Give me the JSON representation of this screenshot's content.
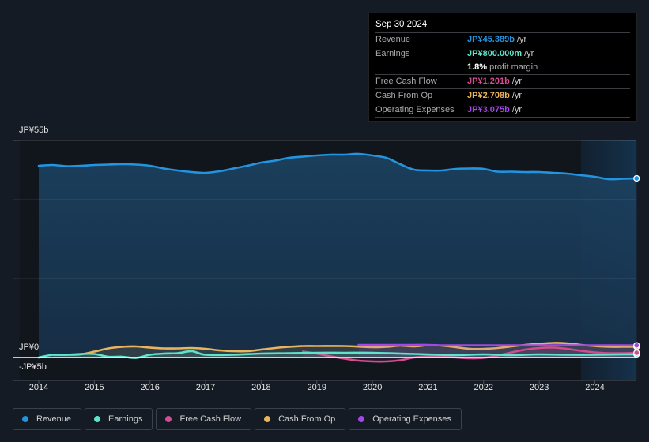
{
  "tooltip": {
    "date": "Sep 30 2024",
    "rows": [
      {
        "label": "Revenue",
        "value": "JP¥45.389b",
        "unit": "/yr",
        "color": "#2394df"
      },
      {
        "label": "Earnings",
        "value": "JP¥800.000m",
        "unit": "/yr",
        "color": "#5fe3ca"
      },
      {
        "label": "Free Cash Flow",
        "value": "JP¥1.201b",
        "unit": "/yr",
        "color": "#d14d8f"
      },
      {
        "label": "Cash From Op",
        "value": "JP¥2.708b",
        "unit": "/yr",
        "color": "#e9b45e"
      },
      {
        "label": "Operating Expenses",
        "value": "JP¥3.075b",
        "unit": "/yr",
        "color": "#a347e6"
      }
    ],
    "profit_margin": {
      "value": "1.8%",
      "text": "profit margin"
    }
  },
  "legend": [
    {
      "label": "Revenue",
      "color": "#2394df"
    },
    {
      "label": "Earnings",
      "color": "#5fe3ca"
    },
    {
      "label": "Free Cash Flow",
      "color": "#d14d8f"
    },
    {
      "label": "Cash From Op",
      "color": "#e9b45e"
    },
    {
      "label": "Operating Expenses",
      "color": "#a347e6"
    }
  ],
  "chart_data": {
    "type": "area",
    "title": "",
    "xlabel": "",
    "ylabel": "",
    "ylim": [
      -5,
      55
    ],
    "xlim": [
      2013.7,
      2024.75
    ],
    "y_ticks": [
      {
        "value": 55,
        "label": "JP¥55b"
      },
      {
        "value": 0,
        "label": "JP¥0"
      },
      {
        "value": -5,
        "label": "-JP¥5b"
      }
    ],
    "x_ticks": [
      {
        "value": 2014,
        "label": "2014"
      },
      {
        "value": 2015,
        "label": "2015"
      },
      {
        "value": 2016,
        "label": "2016"
      },
      {
        "value": 2017,
        "label": "2017"
      },
      {
        "value": 2018,
        "label": "2018"
      },
      {
        "value": 2019,
        "label": "2019"
      },
      {
        "value": 2020,
        "label": "2020"
      },
      {
        "value": 2021,
        "label": "2021"
      },
      {
        "value": 2022,
        "label": "2022"
      },
      {
        "value": 2023,
        "label": "2023"
      },
      {
        "value": 2024,
        "label": "2024"
      }
    ],
    "gridlines": [
      55,
      40,
      20
    ],
    "highlight_start": 2023.75,
    "units": "JP¥ billions",
    "series": [
      {
        "name": "Revenue",
        "color": "#2394df",
        "fill": true,
        "x": [
          2014.0,
          2014.25,
          2014.5,
          2014.75,
          2015.0,
          2015.25,
          2015.5,
          2015.75,
          2016.0,
          2016.25,
          2016.5,
          2016.75,
          2017.0,
          2017.25,
          2017.5,
          2017.75,
          2018.0,
          2018.25,
          2018.5,
          2018.75,
          2019.0,
          2019.25,
          2019.5,
          2019.75,
          2020.0,
          2020.25,
          2020.5,
          2020.75,
          2021.0,
          2021.25,
          2021.5,
          2021.75,
          2022.0,
          2022.25,
          2022.5,
          2022.75,
          2023.0,
          2023.25,
          2023.5,
          2023.75,
          2024.0,
          2024.25,
          2024.5,
          2024.75
        ],
        "values": [
          48.6,
          48.8,
          48.5,
          48.6,
          48.8,
          48.9,
          49.0,
          48.9,
          48.6,
          47.9,
          47.4,
          47.0,
          46.8,
          47.2,
          47.9,
          48.6,
          49.4,
          49.9,
          50.6,
          50.9,
          51.2,
          51.4,
          51.4,
          51.6,
          51.2,
          50.6,
          49.0,
          47.6,
          47.4,
          47.4,
          47.8,
          47.9,
          47.8,
          47.1,
          47.1,
          47.0,
          47.0,
          46.8,
          46.6,
          46.2,
          45.8,
          45.2,
          45.3,
          45.4
        ]
      },
      {
        "name": "Earnings",
        "color": "#5fe3ca",
        "fill": false,
        "x": [
          2014.0,
          2014.25,
          2014.5,
          2014.75,
          2015.0,
          2015.25,
          2015.5,
          2015.75,
          2016.0,
          2016.25,
          2016.5,
          2016.75,
          2017.0,
          2017.5,
          2018.0,
          2018.5,
          2019.0,
          2019.5,
          2020.0,
          2020.5,
          2021.0,
          2021.5,
          2022.0,
          2022.5,
          2023.0,
          2023.5,
          2024.0,
          2024.5,
          2024.75
        ],
        "values": [
          0.0,
          0.7,
          0.7,
          0.9,
          0.9,
          0.2,
          0.2,
          -0.1,
          0.7,
          1.0,
          1.1,
          1.6,
          0.7,
          0.7,
          1.0,
          1.1,
          1.2,
          1.2,
          1.2,
          1.0,
          0.8,
          0.6,
          0.8,
          0.6,
          0.8,
          0.7,
          0.7,
          0.8,
          0.8
        ]
      },
      {
        "name": "Free Cash Flow",
        "color": "#d14d8f",
        "fill": false,
        "x": [
          2018.75,
          2019.0,
          2019.25,
          2019.5,
          2019.75,
          2020.0,
          2020.25,
          2020.5,
          2020.75,
          2021.0,
          2021.25,
          2021.5,
          2021.75,
          2022.0,
          2022.25,
          2022.5,
          2022.75,
          2023.0,
          2023.25,
          2023.5,
          2023.75,
          2024.0,
          2024.25,
          2024.5,
          2024.75
        ],
        "values": [
          1.5,
          1.0,
          0.3,
          -0.3,
          -0.8,
          -1.0,
          -1.0,
          -0.7,
          0.0,
          0.3,
          0.2,
          0.0,
          -0.2,
          -0.1,
          0.5,
          1.3,
          2.0,
          2.4,
          2.5,
          2.2,
          1.7,
          1.3,
          1.1,
          1.1,
          1.2
        ]
      },
      {
        "name": "Cash From Op",
        "color": "#e9b45e",
        "fill": false,
        "x": [
          2014.25,
          2014.5,
          2014.75,
          2015.0,
          2015.25,
          2015.5,
          2015.75,
          2016.0,
          2016.25,
          2016.5,
          2016.75,
          2017.0,
          2017.25,
          2017.5,
          2017.75,
          2018.0,
          2018.25,
          2018.5,
          2018.75,
          2019.0,
          2019.5,
          2020.0,
          2020.25,
          2020.5,
          2020.75,
          2021.0,
          2021.25,
          2021.5,
          2021.75,
          2022.0,
          2022.25,
          2022.5,
          2022.75,
          2023.0,
          2023.25,
          2023.5,
          2023.75,
          2024.0,
          2024.25,
          2024.5,
          2024.75
        ],
        "values": [
          0.7,
          0.7,
          0.8,
          1.5,
          2.3,
          2.7,
          2.8,
          2.5,
          2.3,
          2.3,
          2.4,
          2.2,
          1.8,
          1.6,
          1.6,
          2.0,
          2.4,
          2.7,
          2.9,
          2.9,
          2.9,
          2.6,
          2.7,
          3.0,
          2.8,
          3.1,
          3.0,
          2.6,
          2.2,
          2.2,
          2.4,
          2.8,
          3.2,
          3.5,
          3.7,
          3.6,
          3.2,
          2.9,
          2.7,
          2.7,
          2.7
        ]
      },
      {
        "name": "Operating Expenses",
        "color": "#a347e6",
        "fill": false,
        "x": [
          2019.75,
          2020.0,
          2020.25,
          2020.5,
          2020.75,
          2021.0,
          2021.25,
          2021.5,
          2021.75,
          2022.0,
          2022.25,
          2022.5,
          2022.75,
          2023.0,
          2023.25,
          2023.5,
          2023.75,
          2024.0,
          2024.25,
          2024.5,
          2024.75
        ],
        "values": [
          3.2,
          3.2,
          3.2,
          3.2,
          3.2,
          3.2,
          3.1,
          3.1,
          3.1,
          3.1,
          3.1,
          3.1,
          3.1,
          3.1,
          3.1,
          3.1,
          3.1,
          3.1,
          3.1,
          3.1,
          3.075
        ]
      }
    ]
  }
}
